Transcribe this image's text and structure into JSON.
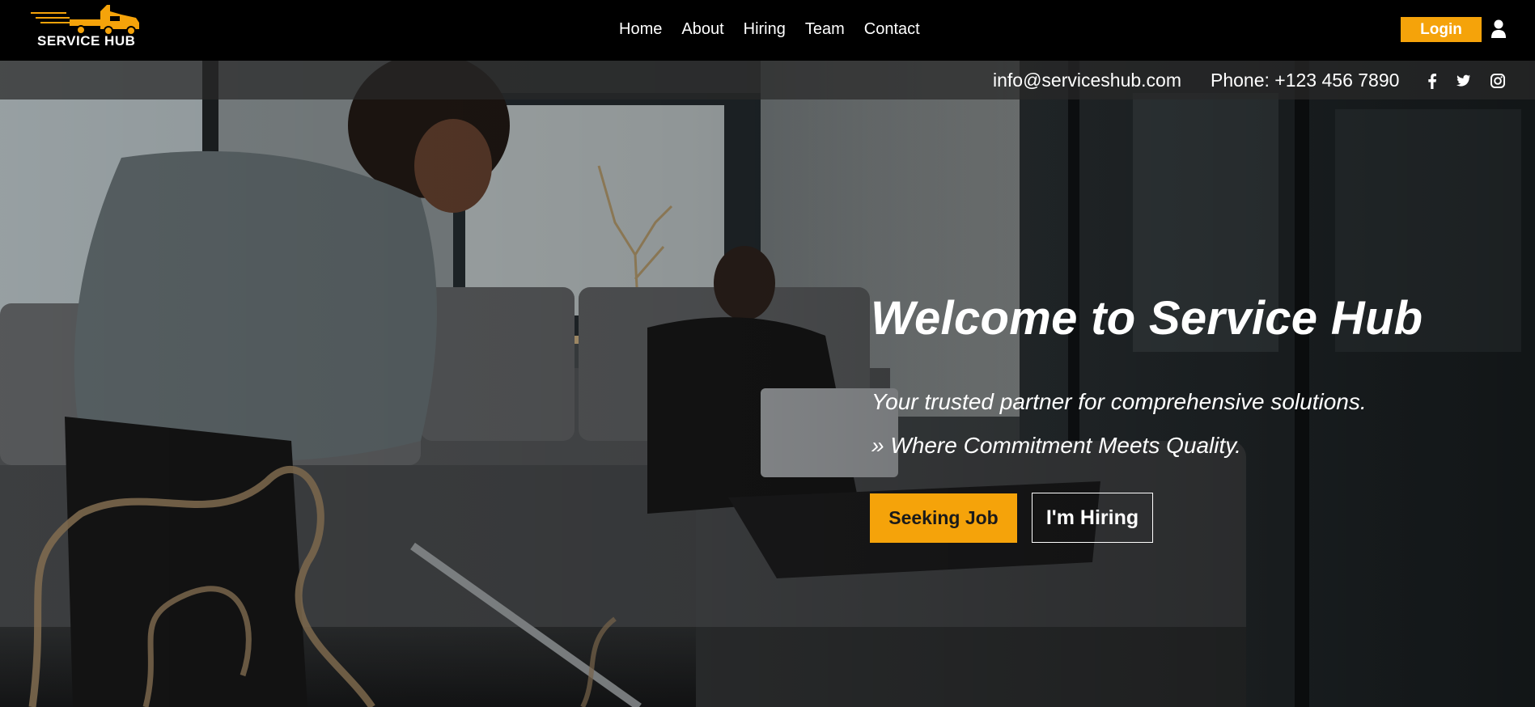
{
  "brand": {
    "logo_text": "SERVICE HUB",
    "accent": "#f5a30a"
  },
  "nav": {
    "items": [
      "Home",
      "About",
      "Hiring",
      "Team",
      "Contact"
    ],
    "login_label": "Login",
    "user_icon": "user-icon"
  },
  "contact_bar": {
    "email": "info@serviceshub.com",
    "phone": "Phone: +123 456 7890",
    "social_icons": [
      "facebook-icon",
      "twitter-icon",
      "instagram-icon"
    ]
  },
  "hero": {
    "title": "Welcome to Service Hub",
    "subtitle": "Your trusted partner for comprehensive solutions.",
    "tagline": "» Where Commitment Meets Quality.",
    "primary_button": "Seeking Job",
    "secondary_button": "I'm Hiring"
  }
}
